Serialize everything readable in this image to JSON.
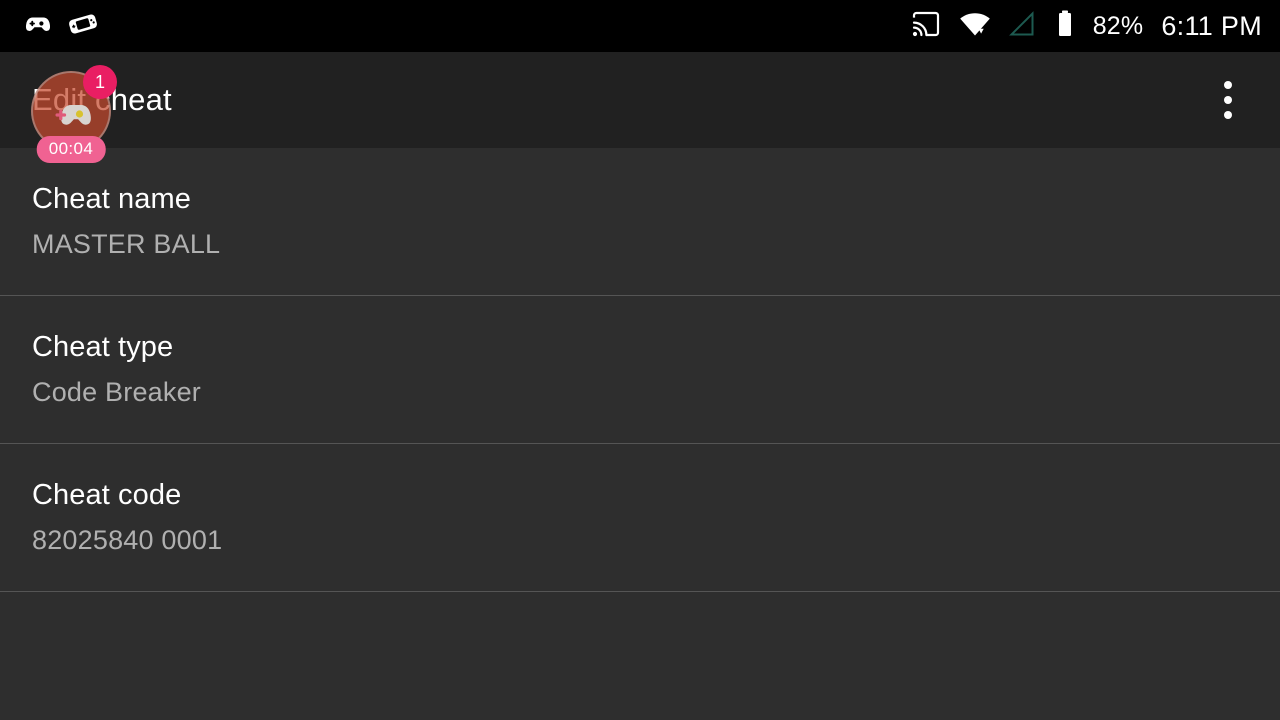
{
  "status_bar": {
    "notification_icons": [
      {
        "name": "gamepad-icon",
        "label": "Gamepad notification"
      },
      {
        "name": "handheld-console-icon",
        "label": "Handheld console notification"
      }
    ],
    "system_icons": [
      {
        "name": "cast-icon",
        "label": "Cast"
      },
      {
        "name": "wifi-icon",
        "label": "Wi-Fi"
      },
      {
        "name": "signal-icon",
        "label": "No mobile signal"
      },
      {
        "name": "battery-icon",
        "label": "Battery"
      }
    ],
    "battery_percent": "82%",
    "clock": "6:11 PM"
  },
  "toolbar": {
    "title": "Edit cheat",
    "overflow_menu_label": "More options"
  },
  "floating_widget": {
    "icon_name": "gamepad-icon",
    "badge_count": "1",
    "recording_time": "00:04"
  },
  "list": {
    "items": [
      {
        "title": "Cheat name",
        "value": "MASTER BALL",
        "name": "cheat-name"
      },
      {
        "title": "Cheat type",
        "value": "Code Breaker",
        "name": "cheat-type"
      },
      {
        "title": "Cheat code",
        "value": "82025840 0001",
        "name": "cheat-code"
      }
    ]
  },
  "colors": {
    "background": "#2e2e2e",
    "toolbar": "#212121",
    "status_bar": "#000000",
    "divider": "#555555",
    "primary_text": "#ffffff",
    "secondary_text": "#b0b0b0",
    "accent_badge": "#e91e63",
    "accent_timer": "#f06292",
    "widget_circle": "#c54a2e",
    "signal_outline": "#1d4b44"
  }
}
